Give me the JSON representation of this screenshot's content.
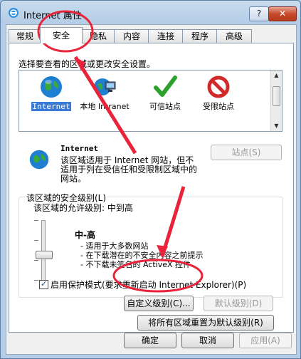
{
  "window": {
    "title": "Internet 属性",
    "help": "?",
    "close": "✕"
  },
  "tabs": [
    "常规",
    "安全",
    "隐私",
    "内容",
    "连接",
    "程序",
    "高级"
  ],
  "zones": {
    "prompt": "选择要查看的区域或更改安全设置。",
    "items": [
      "Internet",
      "本地 Intranet",
      "可信站点",
      "受限站点"
    ]
  },
  "info": {
    "name": "Internet",
    "desc": "该区域适用于 Internet 网站，但不适用于列在受信任和受限制区域中的网站。",
    "sites_button": "站点(S)"
  },
  "security": {
    "group_title": "该区域的安全级别(L)",
    "allowed": "该区域的允许级别: 中到高",
    "level_name": "中-高",
    "level_desc": [
      "- 适用于大多数网站",
      "- 在下载潜在的不安全内容之前提示",
      "- 不下载未签名的 ActiveX 控件"
    ],
    "protect_mode": "启用保护模式(要求重新启动 Internet Explorer)(P)",
    "custom_button": "自定义级别(C)...",
    "default_button": "默认级别(D)",
    "reset_all_button": "将所有区域重置为默认级别(R)"
  },
  "footer": {
    "ok": "确定",
    "cancel": "取消",
    "apply": "应用(A)"
  },
  "colors": {
    "annotation": "#e8233a",
    "selection": "#3a7bd5"
  }
}
